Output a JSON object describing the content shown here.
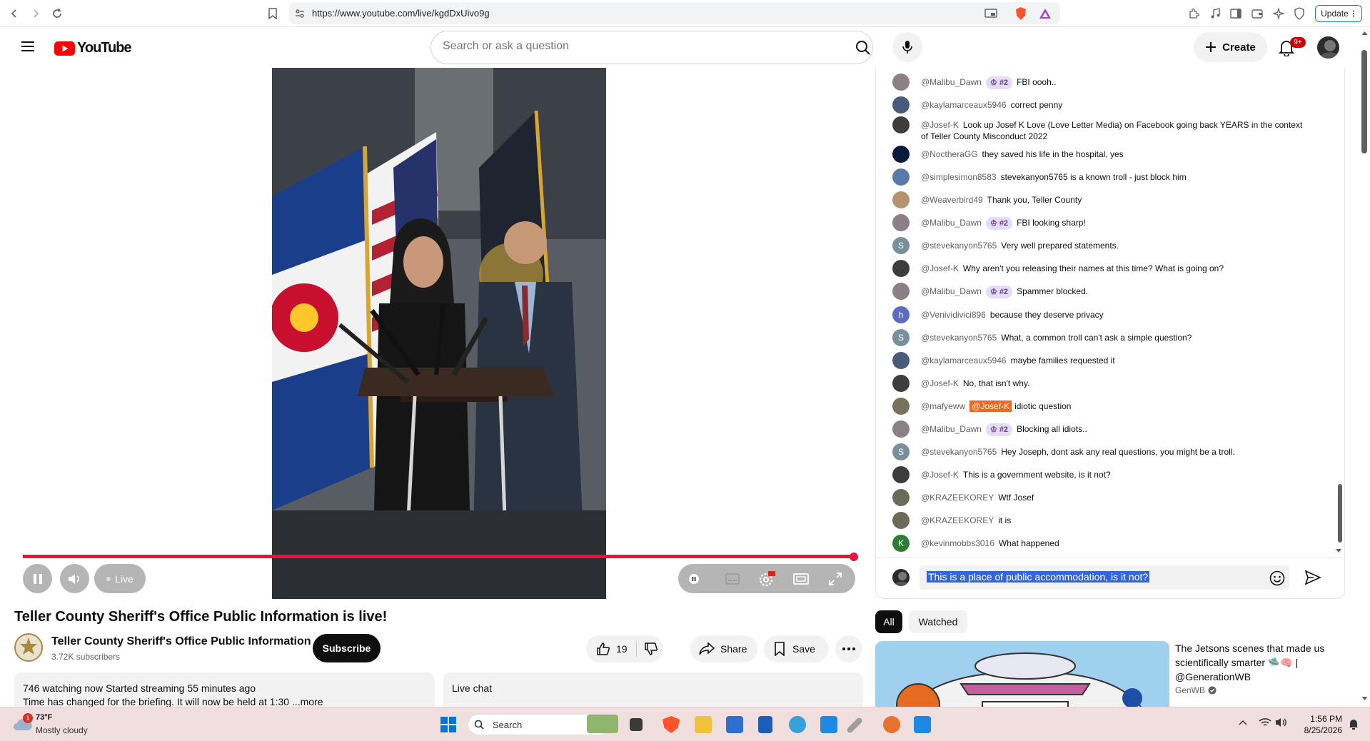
{
  "browser": {
    "url": "https://www.youtube.com/live/kgdDxUivo9g",
    "update_label": "Update"
  },
  "header": {
    "logo_text": "YouTube",
    "search_placeholder": "Search or ask a question",
    "create_label": "Create",
    "notif_count": "9+"
  },
  "player": {
    "live_label": "Live",
    "progress_fraction": 1.0
  },
  "video": {
    "title": "Teller County Sheriff's Office Public Information is live!",
    "channel_name": "Teller County Sheriff's Office Public Information",
    "subscribers": "3.72K subscribers",
    "subscribe_label": "Subscribe",
    "likes": "19",
    "share_label": "Share",
    "save_label": "Save",
    "desc_stats": "746 watching now  Started streaming 55 minutes ago",
    "desc_text": "Time has changed for the briefing. It will now be held at 1:30 ...more",
    "livechat_label": "Live chat"
  },
  "chat": {
    "messages": [
      {
        "author": "@Malibu_Dawn",
        "badge": "#2",
        "text": "FBI oooh..",
        "avatar_color": "#8c7f86",
        "avatar_letter": ""
      },
      {
        "author": "@kaylamarceaux5946",
        "badge": "",
        "text": "correct penny",
        "avatar_color": "#4a5a7a",
        "avatar_letter": ""
      },
      {
        "author": "@Josef-K",
        "badge": "",
        "text": "Look up Josef K Love (Love Letter Media) on Facebook going back YEARS in the context of Teller County Misconduct 2022",
        "avatar_color": "#3d3d3d",
        "avatar_letter": ""
      },
      {
        "author": "@NoctheraGG",
        "badge": "",
        "text": "they saved his life in the hospital, yes",
        "avatar_color": "#0a1a3a",
        "avatar_letter": ""
      },
      {
        "author": "@simplesimon8583",
        "badge": "",
        "text": "stevekanyon5765 is a known troll - just block him",
        "avatar_color": "#5a7aa8",
        "avatar_letter": ""
      },
      {
        "author": "@Weaverbird49",
        "badge": "",
        "text": "Thank you, Teller County",
        "avatar_color": "#b59270",
        "avatar_letter": ""
      },
      {
        "author": "@Malibu_Dawn",
        "badge": "#2",
        "text": "FBI looking sharp!",
        "avatar_color": "#8c7f86",
        "avatar_letter": ""
      },
      {
        "author": "@stevekanyon5765",
        "badge": "",
        "text": "Very well prepared statements.",
        "avatar_color": "#78909c",
        "avatar_letter": "S"
      },
      {
        "author": "@Josef-K",
        "badge": "",
        "text": "Why aren't you releasing their names at this time? What is going on?",
        "avatar_color": "#3d3d3d",
        "avatar_letter": ""
      },
      {
        "author": "@Malibu_Dawn",
        "badge": "#2",
        "text": "Spammer blocked.",
        "avatar_color": "#8c7f86",
        "avatar_letter": ""
      },
      {
        "author": "@Venividivici896",
        "badge": "",
        "text": "because they deserve privacy",
        "avatar_color": "#5c6bc0",
        "avatar_letter": "h"
      },
      {
        "author": "@stevekanyon5765",
        "badge": "",
        "text": "What, a common troll can't ask a simple question?",
        "avatar_color": "#78909c",
        "avatar_letter": "S"
      },
      {
        "author": "@kaylamarceaux5946",
        "badge": "",
        "text": "maybe families requested it",
        "avatar_color": "#4a5a7a",
        "avatar_letter": ""
      },
      {
        "author": "@Josef-K",
        "badge": "",
        "text": "No, that isn't why.",
        "avatar_color": "#3d3d3d",
        "avatar_letter": ""
      },
      {
        "author": "@mafyeww",
        "badge": "",
        "mention": "@Josef-K",
        "text": "idiotic question",
        "avatar_color": "#7a7060",
        "avatar_letter": ""
      },
      {
        "author": "@Malibu_Dawn",
        "badge": "#2",
        "text": "Blocking all idiots..",
        "avatar_color": "#8c7f86",
        "avatar_letter": ""
      },
      {
        "author": "@stevekanyon5765",
        "badge": "",
        "text": "Hey Joseph, dont ask any real questions, you might be a troll.",
        "avatar_color": "#78909c",
        "avatar_letter": "S"
      },
      {
        "author": "@Josef-K",
        "badge": "",
        "text": "This is a government website, is it not?",
        "avatar_color": "#3d3d3d",
        "avatar_letter": ""
      },
      {
        "author": "@KRAZEEKOREY",
        "badge": "",
        "text": "Wtf Josef",
        "avatar_color": "#6b6b5a",
        "avatar_letter": ""
      },
      {
        "author": "@KRAZEEKOREY",
        "badge": "",
        "text": "it is",
        "avatar_color": "#6b6b5a",
        "avatar_letter": ""
      },
      {
        "author": "@kevinmobbs3016",
        "badge": "",
        "text": "What happened",
        "avatar_color": "#2e7d32",
        "avatar_letter": "K"
      }
    ],
    "input_value": "This is a place of public accommodation, is it not?"
  },
  "recs": {
    "chip_all": "All",
    "chip_watched": "Watched",
    "title": "The Jetsons scenes that made us scientifically smarter 🛸🧠 | @GenerationWB",
    "channel": "GenWB"
  },
  "taskbar": {
    "weather_temp": "73°F",
    "weather_desc": "Mostly cloudy",
    "weather_badge": "1",
    "search_label": "Search",
    "time": "1:56 PM",
    "date": "8/25/2026"
  }
}
